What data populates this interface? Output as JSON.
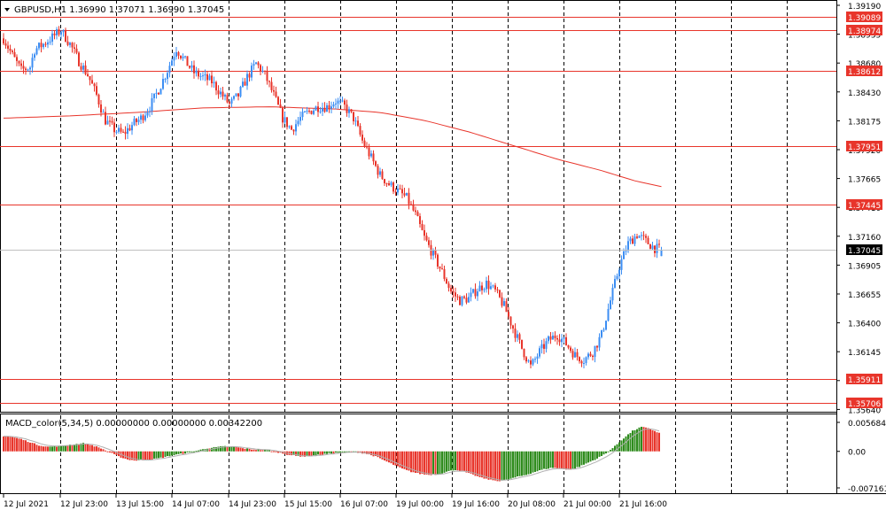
{
  "symbol_header": {
    "text": "GBPUSD,H1  1.36990 1.37071 1.36990 1.37045"
  },
  "macd_header": {
    "text": "MACD_color(5,34,5) 0.00000000 0.00000000 0.00342200"
  },
  "colors": {
    "bull": "#3c8ef3",
    "bear": "#e8352b",
    "level_line": "#e8352b",
    "ma_line": "#e8352b",
    "macd_up": "#2e8b1c",
    "macd_down": "#e8352b",
    "signal_line": "#b0b0b0",
    "grid": "#000000",
    "current_price_bg": "#000000"
  },
  "price_axis": {
    "ticks": [
      "1.39190",
      "1.38935",
      "1.38680",
      "1.38430",
      "1.38175",
      "1.37920",
      "1.37665",
      "1.37410",
      "1.37160",
      "1.36905",
      "1.36655",
      "1.36400",
      "1.36145",
      "1.35890",
      "1.35640"
    ],
    "level_labels": [
      "1.39089",
      "1.38974",
      "1.38612",
      "1.37951",
      "1.37445",
      "1.35911",
      "1.35706"
    ],
    "current_price": "1.37045"
  },
  "macd_axis": {
    "ticks": [
      "0.0056843",
      "0.00",
      "-0.0071613"
    ]
  },
  "time_axis": {
    "labels": [
      "12 Jul 2021",
      "12 Jul 23:00",
      "13 Jul 15:00",
      "14 Jul 07:00",
      "14 Jul 23:00",
      "15 Jul 15:00",
      "16 Jul 07:00",
      "19 Jul 00:00",
      "19 Jul 16:00",
      "20 Jul 08:00",
      "21 Jul 00:00",
      "21 Jul 16:00"
    ]
  },
  "chart_data": {
    "type": "candlestick",
    "symbol": "GBPUSD",
    "timeframe": "H1",
    "last_bar": {
      "open": 1.3699,
      "high": 1.37071,
      "low": 1.3699,
      "close": 1.37045
    },
    "y_range": [
      1.3564,
      1.3919
    ],
    "horizontal_levels": [
      1.39089,
      1.38974,
      1.38612,
      1.37951,
      1.37445,
      1.35911,
      1.35706
    ],
    "close_path": [
      [
        0,
        1.389
      ],
      [
        4,
        1.3875
      ],
      [
        8,
        1.3862
      ],
      [
        12,
        1.3865
      ],
      [
        14,
        1.388
      ],
      [
        18,
        1.3885
      ],
      [
        22,
        1.3891
      ],
      [
        26,
        1.3897
      ],
      [
        30,
        1.3885
      ],
      [
        34,
        1.387
      ],
      [
        38,
        1.3858
      ],
      [
        42,
        1.384
      ],
      [
        46,
        1.3818
      ],
      [
        50,
        1.381
      ],
      [
        54,
        1.3806
      ],
      [
        58,
        1.3814
      ],
      [
        62,
        1.382
      ],
      [
        66,
        1.383
      ],
      [
        70,
        1.3845
      ],
      [
        74,
        1.3862
      ],
      [
        78,
        1.3881
      ],
      [
        82,
        1.387
      ],
      [
        86,
        1.386
      ],
      [
        90,
        1.3856
      ],
      [
        94,
        1.3852
      ],
      [
        98,
        1.3842
      ],
      [
        102,
        1.3832
      ],
      [
        106,
        1.384
      ],
      [
        110,
        1.3856
      ],
      [
        114,
        1.3868
      ],
      [
        118,
        1.3858
      ],
      [
        122,
        1.384
      ],
      [
        126,
        1.382
      ],
      [
        130,
        1.381
      ],
      [
        134,
        1.382
      ],
      [
        138,
        1.3826
      ],
      [
        142,
        1.383
      ],
      [
        146,
        1.383
      ],
      [
        150,
        1.3835
      ],
      [
        154,
        1.383
      ],
      [
        158,
        1.382
      ],
      [
        162,
        1.38
      ],
      [
        166,
        1.3785
      ],
      [
        170,
        1.377
      ],
      [
        174,
        1.3762
      ],
      [
        178,
        1.3756
      ],
      [
        182,
        1.375
      ],
      [
        186,
        1.3735
      ],
      [
        190,
        1.3715
      ],
      [
        194,
        1.37
      ],
      [
        198,
        1.3685
      ],
      [
        202,
        1.3668
      ],
      [
        206,
        1.366
      ],
      [
        210,
        1.3662
      ],
      [
        214,
        1.367
      ],
      [
        218,
        1.3675
      ],
      [
        222,
        1.3668
      ],
      [
        226,
        1.3655
      ],
      [
        230,
        1.3636
      ],
      [
        234,
        1.3618
      ],
      [
        238,
        1.3602
      ],
      [
        242,
        1.3615
      ],
      [
        246,
        1.3625
      ],
      [
        250,
        1.363
      ],
      [
        254,
        1.3622
      ],
      [
        258,
        1.3612
      ],
      [
        262,
        1.3608
      ],
      [
        266,
        1.3615
      ],
      [
        270,
        1.363
      ],
      [
        274,
        1.366
      ],
      [
        278,
        1.369
      ],
      [
        282,
        1.371
      ],
      [
        286,
        1.3718
      ],
      [
        290,
        1.3712
      ],
      [
        294,
        1.3706
      ],
      [
        297,
        1.37045
      ]
    ],
    "moving_average": [
      [
        0,
        1.382
      ],
      [
        30,
        1.3822
      ],
      [
        60,
        1.3825
      ],
      [
        90,
        1.3829
      ],
      [
        120,
        1.383
      ],
      [
        150,
        1.3828
      ],
      [
        170,
        1.3825
      ],
      [
        190,
        1.3818
      ],
      [
        210,
        1.3808
      ],
      [
        230,
        1.3796
      ],
      [
        250,
        1.3784
      ],
      [
        270,
        1.3774
      ],
      [
        285,
        1.3765
      ],
      [
        297,
        1.376
      ]
    ],
    "macd": {
      "ticks": [
        0.0056843,
        0.0,
        -0.0071613
      ],
      "values": [
        0.003,
        0.0028,
        0.0024,
        0.0018,
        0.0012,
        0.0009,
        0.001,
        0.0012,
        0.0014,
        0.0016,
        0.0012,
        0.0006,
        -0.0002,
        -0.001,
        -0.0016,
        -0.0018,
        -0.0017,
        -0.0015,
        -0.0012,
        -0.0008,
        -0.0005,
        -0.0002,
        0.0002,
        0.0006,
        0.0008,
        0.001,
        0.0009,
        0.0006,
        0.0004,
        0.0003,
        0.0002,
        -0.0002,
        -0.0006,
        -0.0009,
        -0.001,
        -0.0008,
        -0.0006,
        -0.0004,
        -0.0002,
        -0.0001,
        -0.0002,
        -0.0005,
        -0.001,
        -0.0018,
        -0.0026,
        -0.0034,
        -0.004,
        -0.0044,
        -0.0046,
        -0.0045,
        -0.004,
        -0.0036,
        -0.004,
        -0.0046,
        -0.0052,
        -0.0056,
        -0.0058,
        -0.0055,
        -0.005,
        -0.0046,
        -0.004,
        -0.0035,
        -0.0032,
        -0.0034,
        -0.0036,
        -0.003,
        -0.0022,
        -0.0014,
        -0.0004,
        0.001,
        0.0026,
        0.004,
        0.0048,
        0.0044,
        0.0036
      ]
    }
  }
}
